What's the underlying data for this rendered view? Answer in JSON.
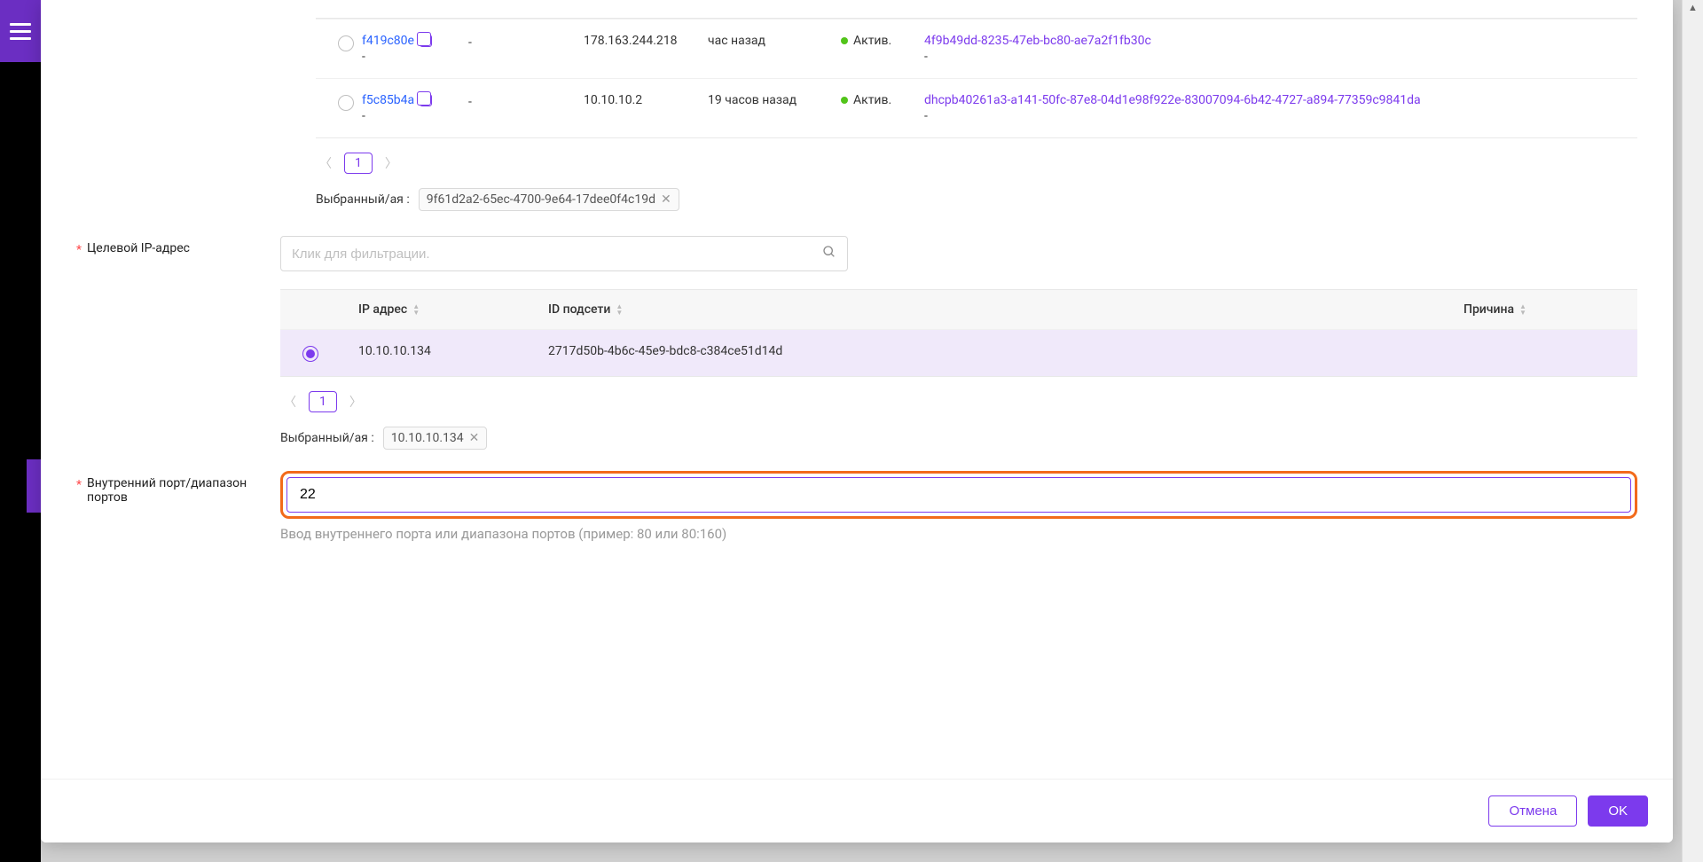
{
  "hosts_table": {
    "rows": [
      {
        "id": "f419c80e",
        "sub": "-",
        "dash": "-",
        "ip": "178.163.244.218",
        "time": "час назад",
        "status": "Актив.",
        "cidr_line1": "4f9b49dd-8235-47eb-bc80-ae7a2f1fb30c",
        "cidr_line2": "-"
      },
      {
        "id": "f5c85b4a",
        "sub": "-",
        "dash": "-",
        "ip": "10.10.10.2",
        "time": "19 часов назад",
        "status": "Актив.",
        "cidr_line1": "dhcpb40261a3-a141-50fc-87e8-04d1e98f922e-83007094-6b42-4727-a894-77359c9841da",
        "cidr_line2": "-"
      }
    ]
  },
  "selected_label": "Выбранный/ая :",
  "selected_host_tag": "9f61d2a2-65ec-4700-9e64-17dee0f4c19d",
  "target_ip_label": "Целевой IP-адрес",
  "filter_placeholder": "Клик для фильтрации.",
  "ip_table": {
    "headers": {
      "ip": "IP адрес",
      "subnet": "ID подсети",
      "reason": "Причина"
    },
    "rows": [
      {
        "ip": "10.10.10.134",
        "subnet": "2717d50b-4b6c-45e9-bdc8-c384ce51d14d",
        "reason": ""
      }
    ]
  },
  "selected_ip_tag": "10.10.10.134",
  "port_label": "Внутренний порт/диапазон портов",
  "port_value": "22",
  "port_helper": "Ввод внутреннего порта или диапазона портов (пример: 80 или 80:160)",
  "pagination_page": "1",
  "buttons": {
    "cancel": "Отмена",
    "ok": "OK"
  }
}
